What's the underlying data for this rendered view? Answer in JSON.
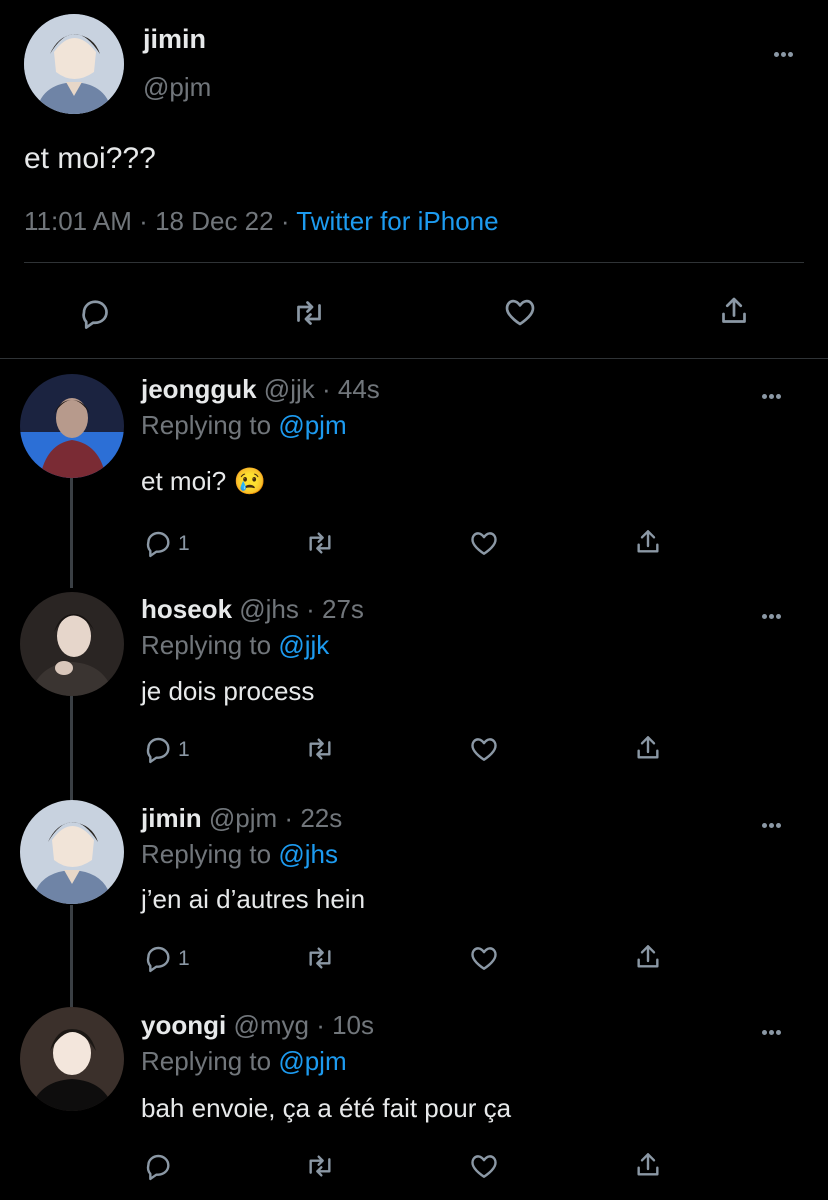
{
  "main_tweet": {
    "author_name": "jimin",
    "author_handle": "@pjm",
    "text": "et moi???",
    "time": "11:01 AM",
    "date": "18 Dec 22",
    "separator": "·",
    "source": "Twitter for iPhone"
  },
  "replies": [
    {
      "name": "jeongguk",
      "handle": "@jjk",
      "time_ago": "44s",
      "replying_label": "Replying to",
      "replying_to": "@pjm",
      "text": "et moi? 😢",
      "reply_count": "1"
    },
    {
      "name": "hoseok",
      "handle": "@jhs",
      "time_ago": "27s",
      "replying_label": "Replying to",
      "replying_to": "@jjk",
      "text": "je dois process",
      "reply_count": "1"
    },
    {
      "name": "jimin",
      "handle": "@pjm",
      "time_ago": "22s",
      "replying_label": "Replying to",
      "replying_to": "@jhs",
      "text": "j’en ai d’autres hein",
      "reply_count": "1"
    },
    {
      "name": "yoongi",
      "handle": "@myg",
      "time_ago": "10s",
      "replying_label": "Replying to",
      "replying_to": "@pjm",
      "text": "bah envoie, ça a été fait pour ça",
      "reply_count": ""
    }
  ],
  "colors": {
    "background": "#000000",
    "text": "#e7e9ea",
    "muted": "#71767b",
    "accent": "#1d9bf0",
    "divider": "#2f3336"
  },
  "icons": [
    "more-icon",
    "reply-icon",
    "retweet-icon",
    "like-icon",
    "share-icon"
  ]
}
